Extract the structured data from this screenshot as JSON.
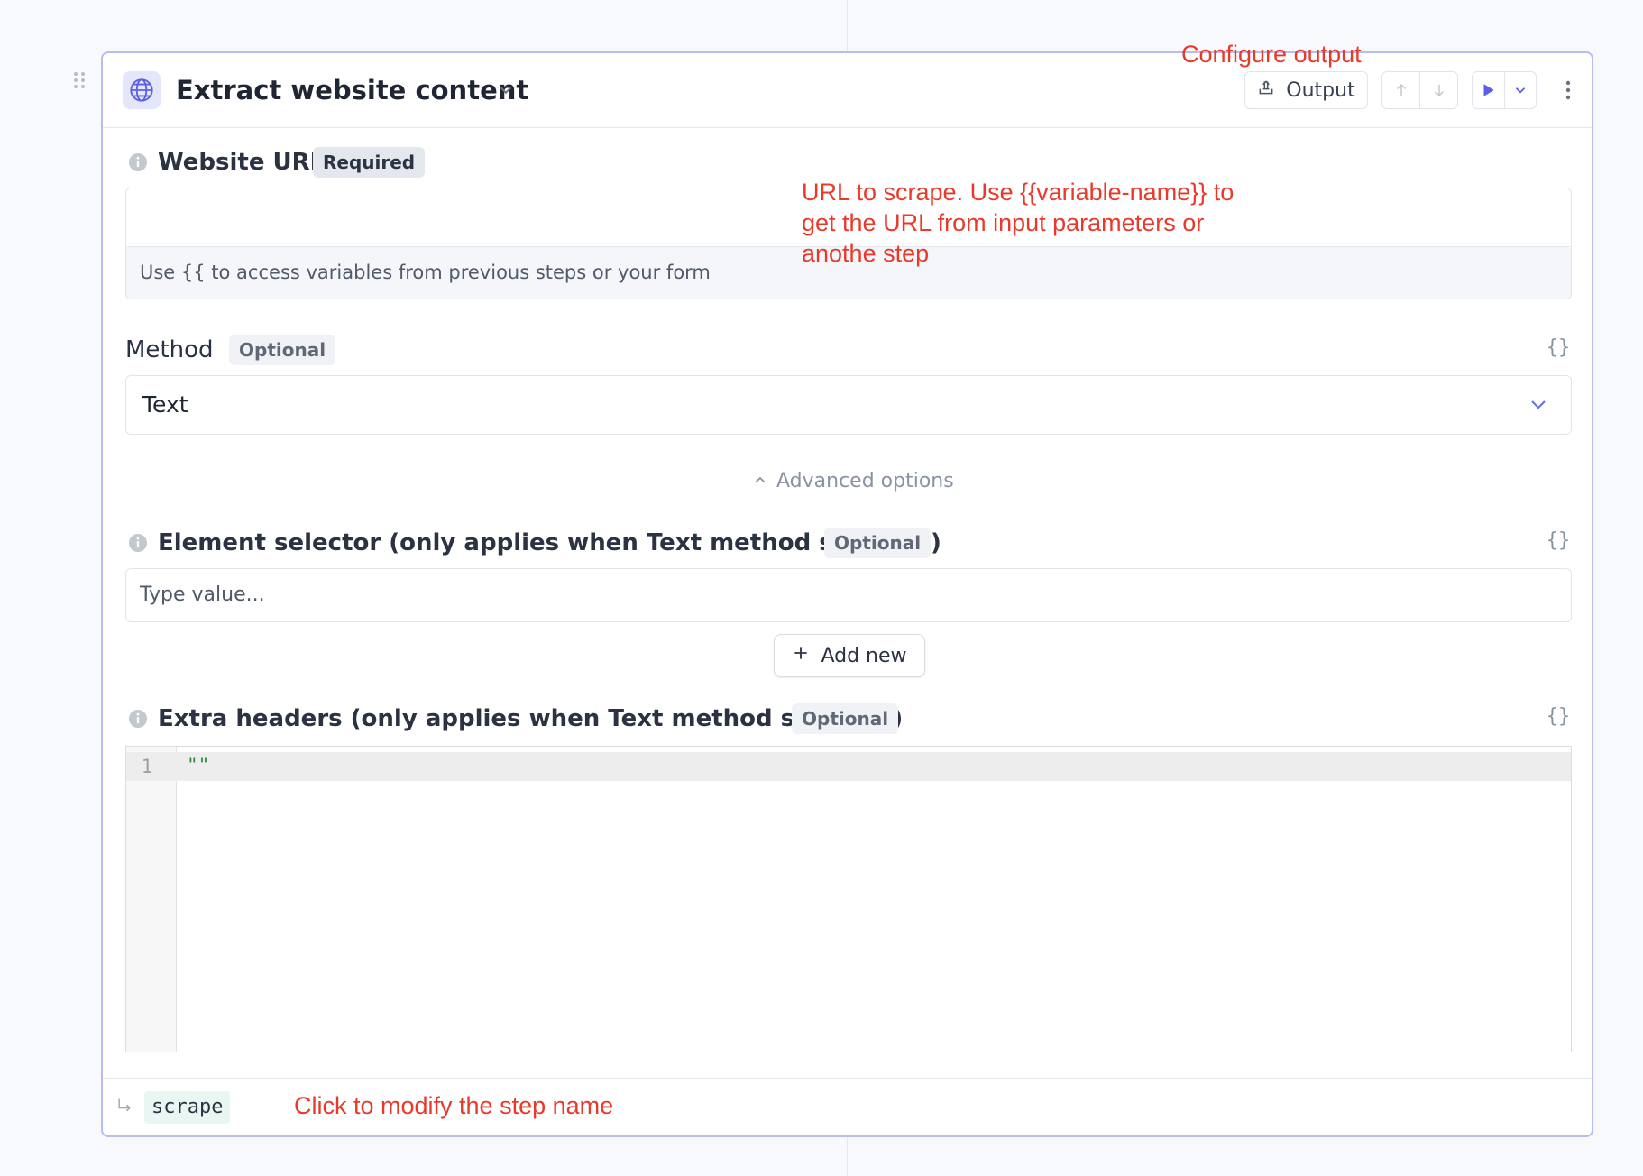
{
  "step": {
    "title": "Extract website content",
    "output_label": "Output",
    "step_name": "scrape"
  },
  "fields": {
    "website_url": {
      "label": "Website URL",
      "badge": "Required",
      "value": "",
      "hint": "Use {{ to access variables from previous steps or your form"
    },
    "method": {
      "label": "Method",
      "badge": "Optional",
      "selected": "Text"
    },
    "advanced_label": "Advanced options",
    "element_selector": {
      "label": "Element selector (only applies when Text method selected)",
      "badge": "Optional",
      "placeholder": "Type value...",
      "add_new_label": "Add new"
    },
    "extra_headers": {
      "label": "Extra headers (only applies when Text method selected)",
      "badge": "Optional",
      "line_number": "1",
      "code": "\"\""
    }
  },
  "icons": {
    "step_icon": "globe-icon",
    "field_info": "info-icon",
    "variables": "braces-icon",
    "run": "play-icon"
  },
  "annotations": {
    "configure_output": "Configure output",
    "url_help_line1": "URL to scrape. Use {{variable-name}} to",
    "url_help_line2": "get the URL from input parameters or",
    "url_help_line3": "anothe step",
    "step_name_help": "Click to modify the step name"
  },
  "colors": {
    "accent": "#6366f1",
    "card_border": "#b8bcf2",
    "annotation": "#e8392a",
    "code_string": "#2e8b2e"
  }
}
